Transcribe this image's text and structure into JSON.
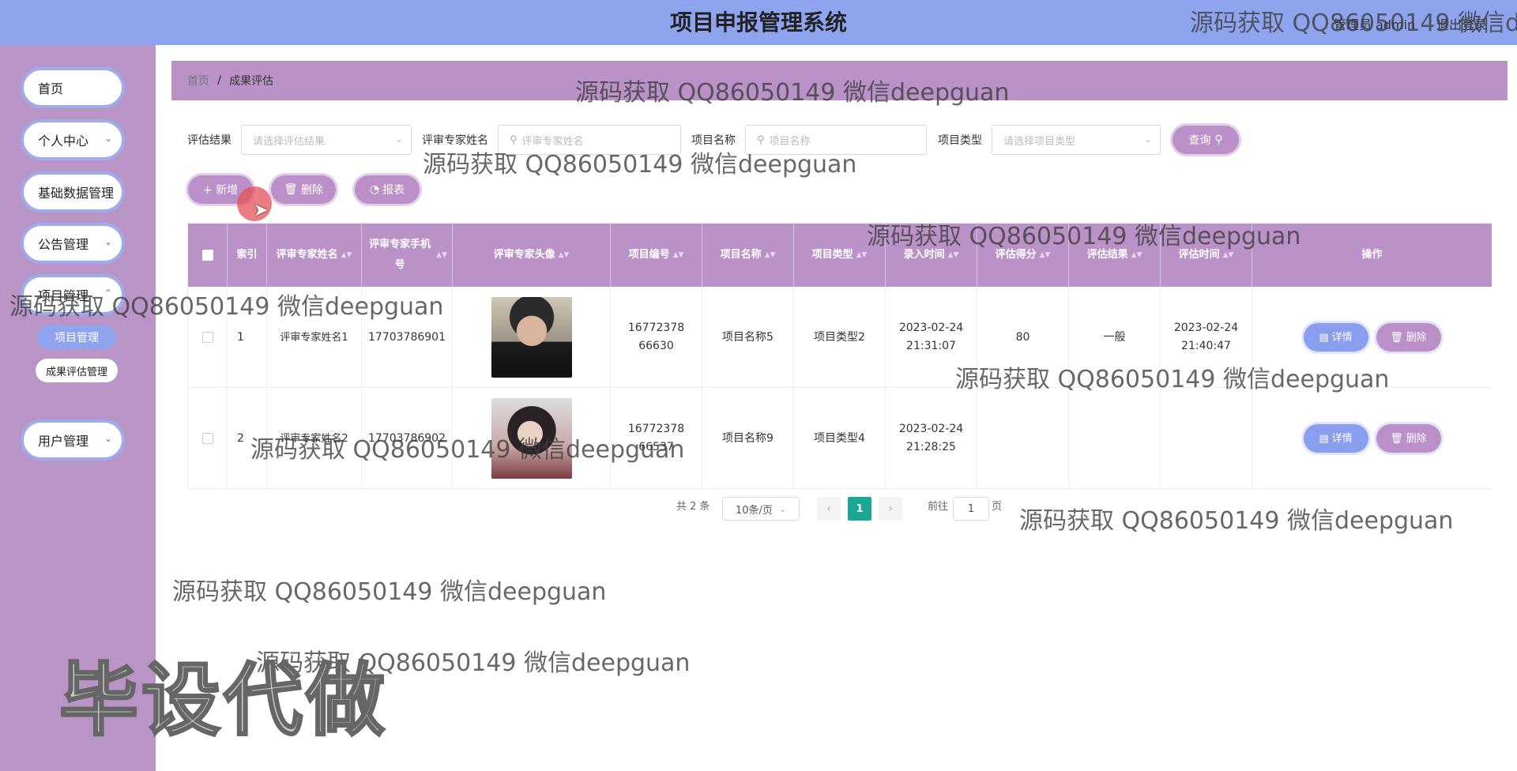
{
  "header": {
    "title": "项目申报管理系统",
    "user_text": "管理员 admin",
    "logout_label": "退出登录"
  },
  "sidebar": {
    "items": [
      {
        "label": "首页"
      },
      {
        "label": "个人中心"
      },
      {
        "label": "基础数据管理"
      },
      {
        "label": "公告管理"
      },
      {
        "label": "项目管理"
      },
      {
        "label": "用户管理"
      }
    ],
    "sub_items": [
      {
        "label": "项目管理"
      },
      {
        "label": "成果评估管理"
      }
    ]
  },
  "breadcrumb": {
    "home": "首页",
    "separator": "/",
    "current": "成果评估"
  },
  "filters": {
    "result_label": "评估结果",
    "result_placeholder": "请选择评估结果",
    "expert_label": "评审专家姓名",
    "expert_placeholder": "评审专家姓名",
    "project_name_label": "项目名称",
    "project_name_placeholder": "项目名称",
    "project_type_label": "项目类型",
    "project_type_placeholder": "请选择项目类型",
    "query_label": "查询"
  },
  "actions": {
    "add_label": "+ 新增",
    "delete_label": "删除",
    "report_label": "报表"
  },
  "table": {
    "columns": [
      "索引",
      "评审专家姓名",
      "评审专家手机号",
      "评审专家头像",
      "项目编号",
      "项目名称",
      "项目类型",
      "录入时间",
      "评估得分",
      "评估结果",
      "评估时间",
      "操作"
    ],
    "rows": [
      {
        "index": "1",
        "expert_name": "评审专家姓名1",
        "phone": "17703786901",
        "project_no": "1677237866630",
        "project_name": "项目名称5",
        "project_type": "项目类型2",
        "entry_time": "2023-02-24 21:31:07",
        "score": "80",
        "result": "一般",
        "eval_time": "2023-02-24 21:40:47"
      },
      {
        "index": "2",
        "expert_name": "评审专家姓名2",
        "phone": "17703786902",
        "project_no": "1677237866537",
        "project_name": "项目名称9",
        "project_type": "项目类型4",
        "entry_time": "2023-02-24 21:28:25",
        "score": "",
        "result": "",
        "eval_time": ""
      }
    ],
    "detail_label": "详情",
    "delete_label": "删除",
    "colors": {
      "detail": "#8a9ef0",
      "delete": "#bb8fc8",
      "header": "#bb92c8"
    }
  },
  "pagination": {
    "total_text": "共 2 条",
    "page_size": "10条/页",
    "current_page": "1",
    "goto_label": "前往",
    "goto_value": "1",
    "page_suffix": "页"
  },
  "watermarks": {
    "text": "源码获取 QQ86050149 微信deepguan",
    "top_text": "源码获取 QQ86050149 微信de",
    "sidebar_text": "源码获取 QQ86050149 微信deepguan",
    "big": "毕设代做"
  }
}
